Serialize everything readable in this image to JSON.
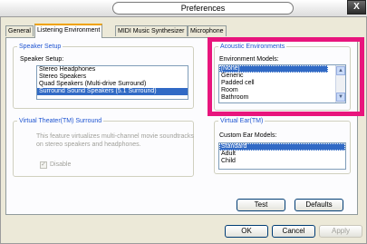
{
  "window": {
    "title": "Preferences",
    "close_glyph": "X"
  },
  "tabs": [
    {
      "label": "General",
      "active": false
    },
    {
      "label": "Listening Environment",
      "active": true
    },
    {
      "label": "MIDI Music Synthesizer",
      "active": false
    },
    {
      "label": "Microphone",
      "active": false
    }
  ],
  "speaker_setup": {
    "group_title": "Speaker Setup",
    "label": "Speaker Setup:",
    "items": [
      "Stereo Headphones",
      "Stereo Speakers",
      "Quad Speakers (Multi-drive Surround)",
      "Surround Sound Speakers (5.1 Surround)"
    ],
    "selected": "Surround Sound Speakers (5.1 Surround)"
  },
  "acoustic": {
    "group_title": "Acoustic Environments",
    "label": "Environment Models:",
    "items": [
      "[None]",
      "Generic",
      "Padded cell",
      "Room",
      "Bathroom"
    ],
    "selected": "[None]"
  },
  "virtual_theater": {
    "group_title": "Virtual Theater(TM) Surround",
    "description": "This feature virtualizes multi-channel movie soundtracks on stereo speakers and headphones.",
    "desc_line1": "This feature virtualizes multi-channel movie soundtracks",
    "desc_line2": "on stereo speakers and headphones.",
    "checkbox_label": "Disable",
    "checkbox_checked": true,
    "enabled": false
  },
  "virtual_ear": {
    "group_title": "Virtual Ear(TM)",
    "label": "Custom Ear Models:",
    "items": [
      "Standard",
      "Adult",
      "Child"
    ],
    "selected": "Standard"
  },
  "buttons": {
    "test": "Test",
    "defaults": "Defaults",
    "ok": "OK",
    "cancel": "Cancel",
    "apply": "Apply"
  },
  "colors": {
    "highlight": "#e8157d",
    "group_title": "#1f55d1",
    "selection": "#316ac5"
  }
}
